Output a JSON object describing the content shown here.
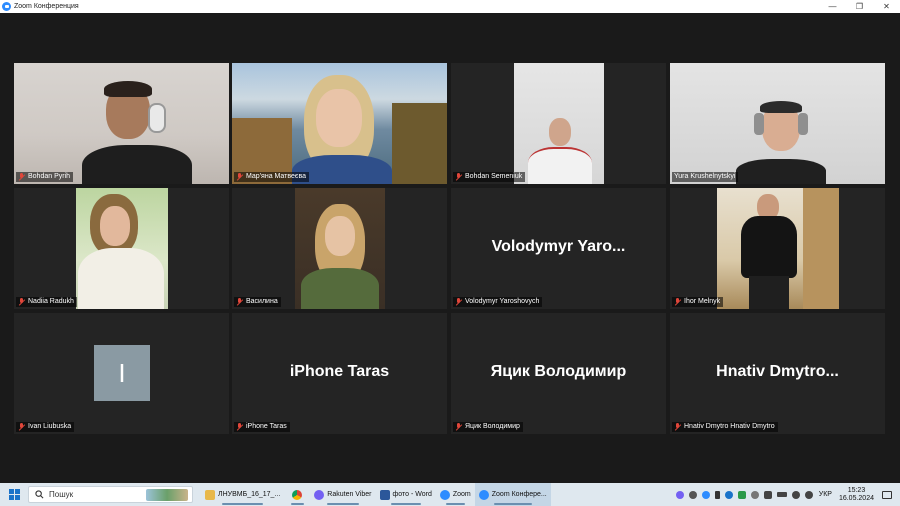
{
  "window": {
    "title": "Zoom Конференция",
    "controls": [
      "—",
      "❐",
      "✕"
    ]
  },
  "participants": [
    {
      "name": "Bohdan Pyrih"
    },
    {
      "name": "Мар'яна Матвеєва"
    },
    {
      "name": "Bohdan Semeniuk"
    },
    {
      "name": "Yura Krushelnytskyi",
      "active_speaker": true
    },
    {
      "name": "Nadiia Radukh"
    },
    {
      "name": "Василина"
    },
    {
      "name": "Volodymyr Yaroshovych",
      "display": "Volodymyr  Yaro..."
    },
    {
      "name": "Ihor Melnyk"
    },
    {
      "name": "Ivan Liubuska",
      "avatar_letter": "I"
    },
    {
      "name": "iPhone Taras",
      "display": "iPhone Taras"
    },
    {
      "name": "Яцик Володимир",
      "display": "Яцик Володимир"
    },
    {
      "name": "Hnativ Dmytro Hnativ Dmytro",
      "display": "Hnativ  Dmytro..."
    }
  ],
  "taskbar": {
    "search_placeholder": "Пошук",
    "items": [
      {
        "label": "ЛНУВМБ_16_17_...",
        "icon": "folder-icon"
      },
      {
        "label": "",
        "icon": "chrome-icon"
      },
      {
        "label": "Rakuten Viber",
        "icon": "viber-icon"
      },
      {
        "label": "фото - Word",
        "icon": "word-icon"
      },
      {
        "label": "Zoom",
        "icon": "zoom-icon"
      },
      {
        "label": "Zoom Конфере...",
        "icon": "zoom-icon"
      }
    ],
    "language": "УКР",
    "time": "15:23",
    "date": "16.05.2024"
  },
  "colors": {
    "active_speaker": "#b5e03a",
    "muted": "#e0463a",
    "zoom_blue": "#2d8cff"
  }
}
